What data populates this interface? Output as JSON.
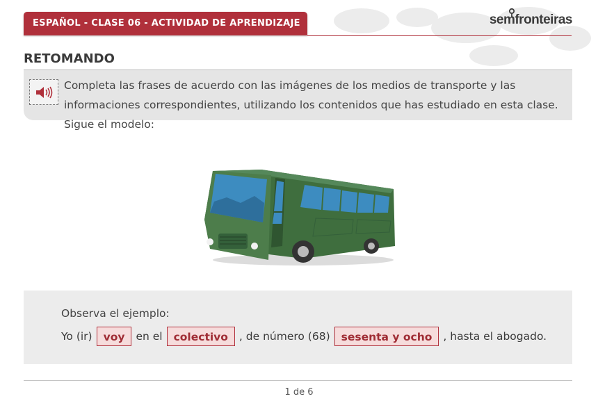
{
  "header": {
    "title": "ESPAÑOL - CLASE 06 - ACTIVIDAD DE APRENDIZAJE",
    "logo_text": "semfronteiras",
    "accent_color": "#b0303b"
  },
  "section": {
    "title": "RETOMANDO"
  },
  "instruction": {
    "audio_icon": "speaker-icon",
    "text": "Completa las frases de acuerdo con las imágenes de los medios de transporte y las informaciones correspondientes, utilizando los contenidos que has estudiado en esta clase. Sigue el modelo:"
  },
  "image": {
    "subject": "bus-illustration",
    "body_color": "#3f6e3e"
  },
  "example": {
    "label": "Observa el ejemplo:",
    "part1": "Yo (ir)",
    "answer1": "voy",
    "part2": "en el",
    "answer2": "colectivo",
    "part3": ", de número (68)",
    "answer3": "sesenta y ocho",
    "part4": ", hasta el abogado."
  },
  "footer": {
    "page": "1 de 6"
  }
}
